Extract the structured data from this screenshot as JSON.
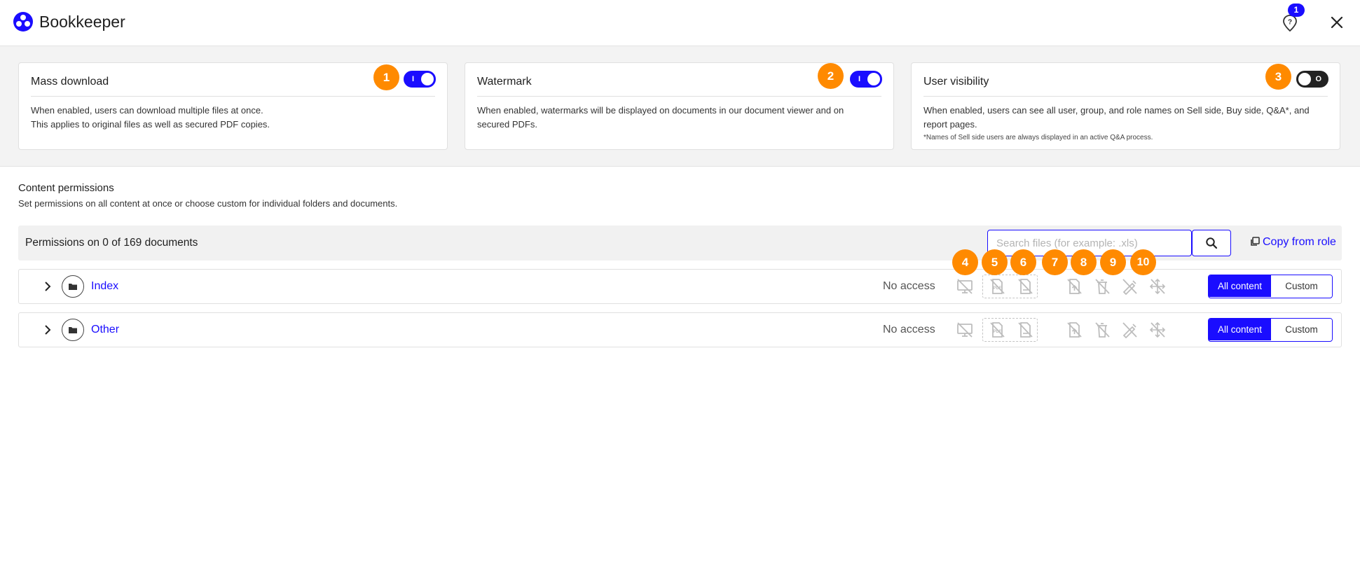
{
  "app": {
    "title": "Bookkeeper",
    "help_badge": "1"
  },
  "icons": {
    "logo": "people-logo-icon",
    "help": "help-location-icon",
    "close": "close-icon",
    "search": "search-icon",
    "copy": "copy-icon",
    "expand": "chevron-right-icon",
    "folder": "folder-icon"
  },
  "colors": {
    "accent": "#1a0dff",
    "callout": "#ff8a00",
    "toggle_off": "#222222"
  },
  "settings": [
    {
      "title": "Mass download",
      "enabled": true,
      "toggle_mark": "I",
      "description": [
        "When enabled, users can download multiple files at once.",
        "This applies to original files as well as secured PDF copies."
      ],
      "note": ""
    },
    {
      "title": "Watermark",
      "enabled": true,
      "toggle_mark": "I",
      "description": [
        "When enabled, watermarks will be displayed on documents in our document viewer and on secured PDFs."
      ],
      "note": ""
    },
    {
      "title": "User visibility",
      "enabled": false,
      "toggle_mark": "O",
      "description": [
        "When enabled, users can see all user, group, and role names on Sell side, Buy side, Q&A*, and report pages."
      ],
      "note": "*Names of Sell side users are always displayed in an active Q&A process."
    }
  ],
  "callouts": [
    "1",
    "2",
    "3",
    "4",
    "5",
    "6",
    "7",
    "8",
    "9",
    "10"
  ],
  "content_permissions": {
    "title": "Content permissions",
    "subtitle": "Set permissions on all content at once or choose custom for individual folders and documents.",
    "count_label": "Permissions on 0 of 169 documents",
    "search_placeholder": "Search files (for example: .xls)",
    "search_value": "",
    "copy_from_role": "Copy from role",
    "permission_icons": [
      "view-disabled-icon",
      "download-pdf-disabled-icon",
      "download-original-disabled-icon",
      "upload-disabled-icon",
      "delete-disabled-icon",
      "edit-disabled-icon",
      "move-disabled-icon"
    ],
    "rows": [
      {
        "name": "Index",
        "access": "No access",
        "all_content": "All content",
        "custom": "Custom"
      },
      {
        "name": "Other",
        "access": "No access",
        "all_content": "All content",
        "custom": "Custom"
      }
    ]
  }
}
